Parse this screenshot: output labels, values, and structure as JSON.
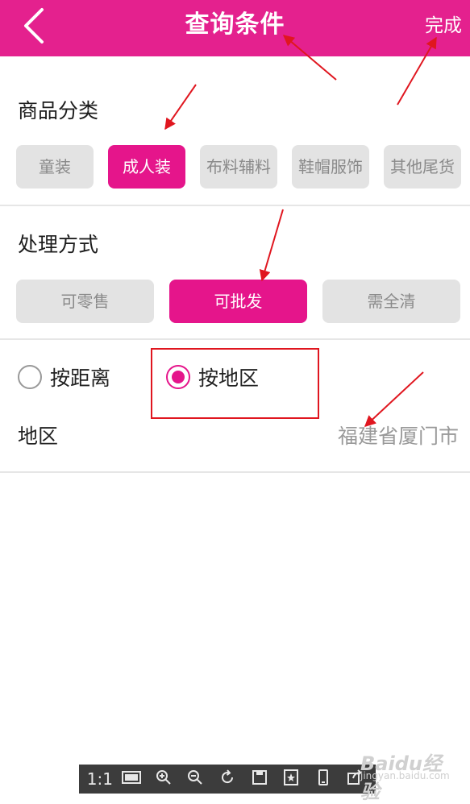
{
  "header": {
    "title": "查询条件",
    "done_label": "完成",
    "back_icon": "chevron-left-icon",
    "background": "#e4218e"
  },
  "category": {
    "title": "商品分类",
    "options": [
      "童装",
      "成人装",
      "布料辅料",
      "鞋帽服饰",
      "其他尾货"
    ],
    "selected": "成人装"
  },
  "processing": {
    "title": "处理方式",
    "options": [
      "可零售",
      "可批发",
      "需全清"
    ],
    "selected": "可批发"
  },
  "location_mode": {
    "options": [
      "按距离",
      "按地区"
    ],
    "selected": "按地区"
  },
  "region": {
    "label": "地区",
    "value": "福建省厦门市"
  },
  "viewer_toolbar": {
    "actual_size_label": "1:1",
    "buttons": [
      "fit-screen-icon",
      "zoom-in-icon",
      "zoom-out-icon",
      "rotate-icon",
      "save-icon",
      "favorite-icon",
      "phone-icon",
      "share-icon"
    ]
  },
  "watermark": {
    "brand": "Baidu经验",
    "url": "jingyan.baidu.com"
  },
  "colors": {
    "accent": "#e5158b",
    "annotation": "#e0161f",
    "chip_inactive": "#e3e3e3"
  }
}
